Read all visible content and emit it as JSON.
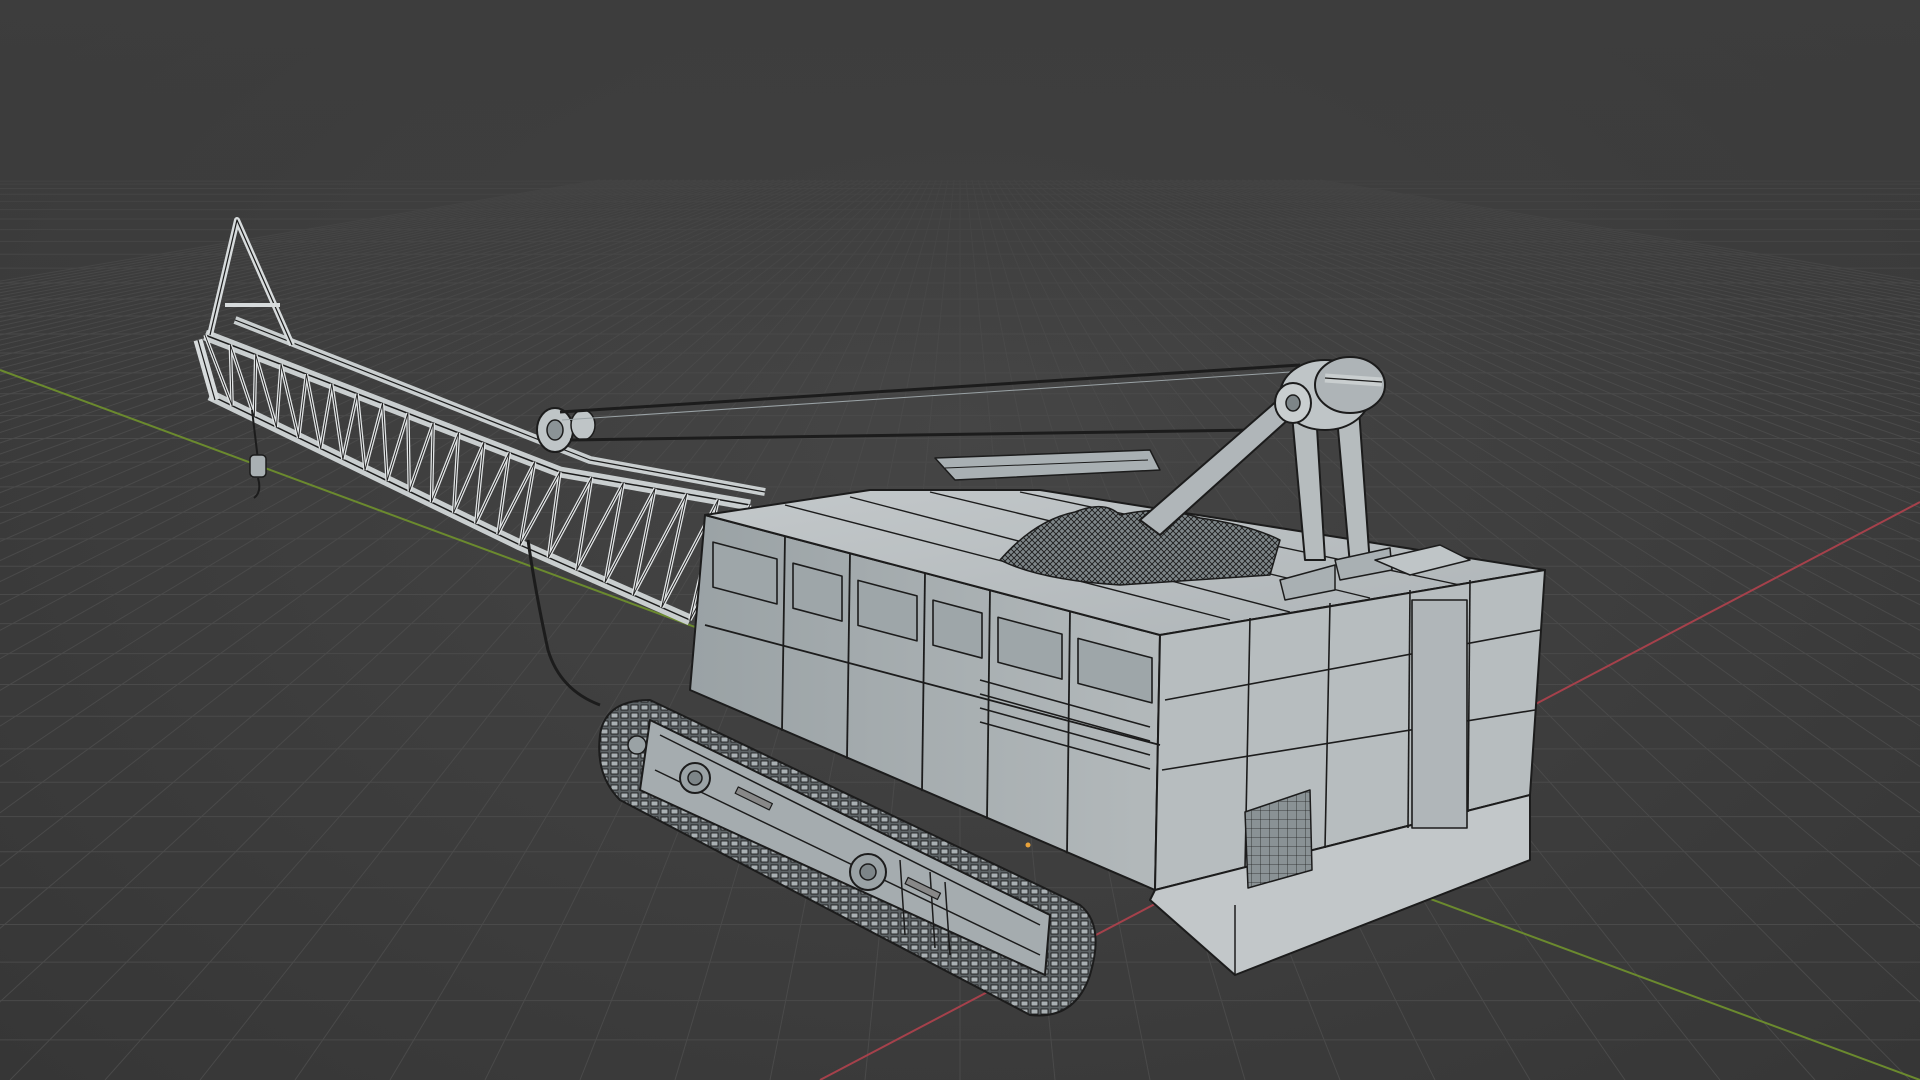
{
  "viewport": {
    "mode": "solid-wireframe-overlay",
    "background": "#3d3d3d",
    "grid_color": "#4a4a4a",
    "axis_x_color": "#a5414b",
    "axis_y_color": "#6b8a2e"
  },
  "scene": {
    "object": "crawler-crane-model",
    "surface_color": "#a9b0b3",
    "wire_color": "#1c1c1c",
    "origin_marker_color": "#e8a23a"
  }
}
